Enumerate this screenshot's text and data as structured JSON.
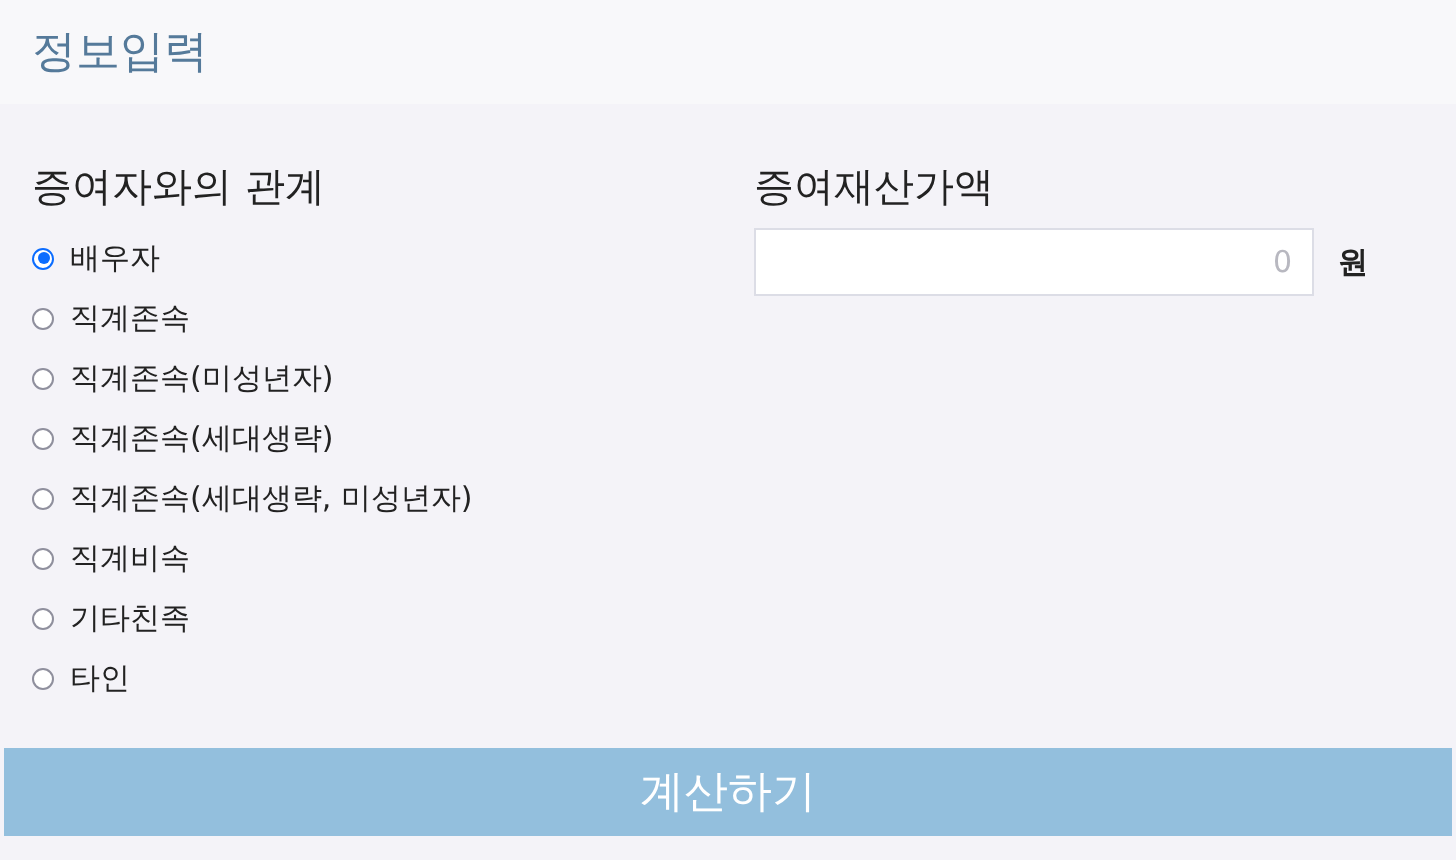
{
  "header": {
    "title": "정보입력"
  },
  "relation": {
    "label": "증여자와의 관계",
    "options": [
      {
        "label": "배우자",
        "selected": true
      },
      {
        "label": "직계존속",
        "selected": false
      },
      {
        "label": "직계존속(미성년자)",
        "selected": false
      },
      {
        "label": "직계존속(세대생략)",
        "selected": false
      },
      {
        "label": "직계존속(세대생략, 미성년자)",
        "selected": false
      },
      {
        "label": "직계비속",
        "selected": false
      },
      {
        "label": "기타친족",
        "selected": false
      },
      {
        "label": "타인",
        "selected": false
      }
    ]
  },
  "amount": {
    "label": "증여재산가액",
    "placeholder": "0",
    "unit": "원"
  },
  "submit": {
    "label": "계산하기"
  }
}
